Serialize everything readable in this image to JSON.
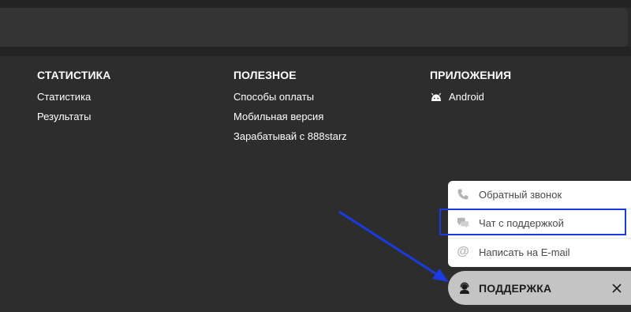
{
  "footer": {
    "columns": [
      {
        "heading": "СТАТИСТИКА",
        "links": [
          "Статистика",
          "Результаты"
        ]
      },
      {
        "heading": "ПОЛЕЗНОЕ",
        "links": [
          "Способы оплаты",
          "Мобильная версия",
          "Зарабатывай с 888starz"
        ]
      },
      {
        "heading": "ПРИЛОЖЕНИЯ",
        "links": [
          "Android"
        ]
      }
    ]
  },
  "support_menu": {
    "items": [
      {
        "label": "Обратный звонок",
        "icon": "phone-icon"
      },
      {
        "label": "Чат с поддержкой",
        "icon": "chat-icon"
      },
      {
        "label": "Написать на E-mail",
        "icon": "at-icon"
      }
    ]
  },
  "support_bar": {
    "label": "ПОДДЕРЖКА",
    "icon": "support-agent-icon",
    "close_icon": "close-icon"
  },
  "annotation": {
    "highlight_color": "#1a3be0",
    "arrow_color": "#1a3be0"
  }
}
